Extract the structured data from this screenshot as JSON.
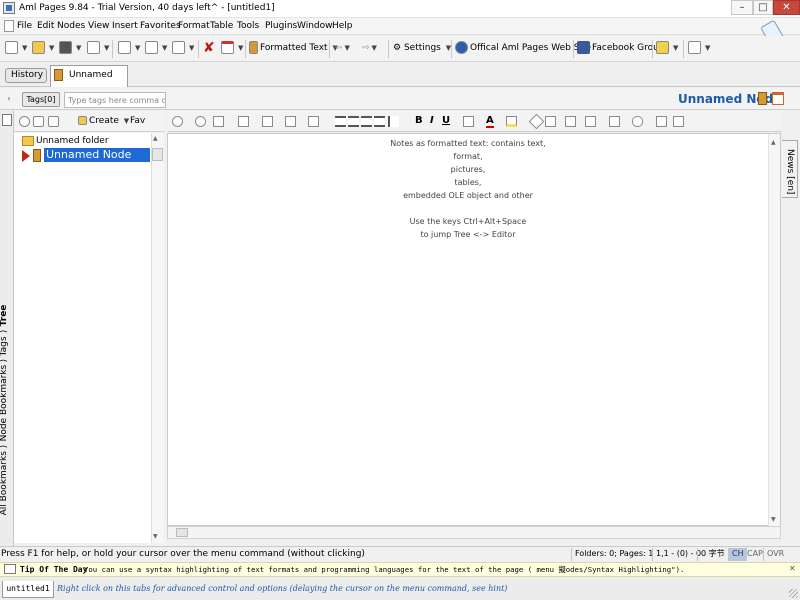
{
  "window": {
    "title": "Aml Pages 9.84 - Trial Version, 40 days left^ - [untitled1]",
    "minimize_glyph": "–",
    "maximize_glyph": "□",
    "close_glyph": "✕"
  },
  "menu": [
    "File",
    "Edit",
    "Nodes",
    "View",
    "Insert",
    "Favorites",
    "Format",
    "Table",
    "Tools",
    "Plugins",
    "Window",
    "Help"
  ],
  "toolbar": {
    "formatted_text": "Formatted Text",
    "settings": "Settings",
    "web_site": "Offical Aml Pages Web Site",
    "facebook": "Facebook Group",
    "delete_glyph": "✘",
    "icons": [
      "new-icon",
      "open-icon",
      "save-icon",
      "print-icon",
      "cut-icon",
      "copy-icon",
      "paste-icon",
      "delete-icon",
      "calendar-icon",
      "node-type-icon",
      "back-icon",
      "forward-icon",
      "settings-icon",
      "web-icon",
      "facebook-icon",
      "help-icon",
      "panel-icon"
    ]
  },
  "tabs": {
    "history": "History",
    "node_tab": "Unnamed Node"
  },
  "tags": {
    "button": "Tags[0]",
    "placeholder": "Type tags here comma d...",
    "back_glyph": "‹"
  },
  "node_title": "Unnamed Node",
  "tree_toolbar": {
    "create": "Create",
    "favorites": "Fav"
  },
  "tree": {
    "folder": "Unnamed folder",
    "selected_node": "Unnamed Node"
  },
  "left_tabs": {
    "all_bookmarks": "All Bookmarks",
    "node_bookmarks": "Node Bookmarks",
    "tags": "Tags",
    "tree": "Tree"
  },
  "editor_toolbar": {
    "bold": "B",
    "italic": "I",
    "underline": "U",
    "font_color": "A"
  },
  "editor": {
    "lines": [
      "Notes as formatted text: contains text,",
      "format,",
      "pictures,",
      "tables,",
      "embedded OLE object and other",
      "",
      "Use the keys Ctrl+Alt+Space",
      "to jump Tree <-> Editor"
    ]
  },
  "news_tab": "News [en]",
  "status": {
    "help": "Press F1 for help, or hold your cursor over the menu command (without clicking)",
    "folders_pages": "Folders: 0; Pages: 1",
    "position": "1,1 - (0) - 0",
    "bytes": "0 字节",
    "ch": "CH",
    "cap": "CAP",
    "ovr": "OVR"
  },
  "tip": {
    "title": "Tip Of The Day",
    "text": "You can use a syntax highlighting of text formats and programming languages for the text of the page ( menu 擬odes/Syntax Highlighting\").",
    "close_glyph": "✕"
  },
  "bottom": {
    "tab": "untitled1",
    "hint": "Right click on this tabs for advanced control and options (delaying the cursor on the menu command, see hint)"
  },
  "colors": {
    "selection": "#1d69d8",
    "title_accent": "#1d5aa8",
    "close_button": "#c7473a",
    "tip_background": "#ffffe0",
    "arrow": "#c0281c"
  }
}
